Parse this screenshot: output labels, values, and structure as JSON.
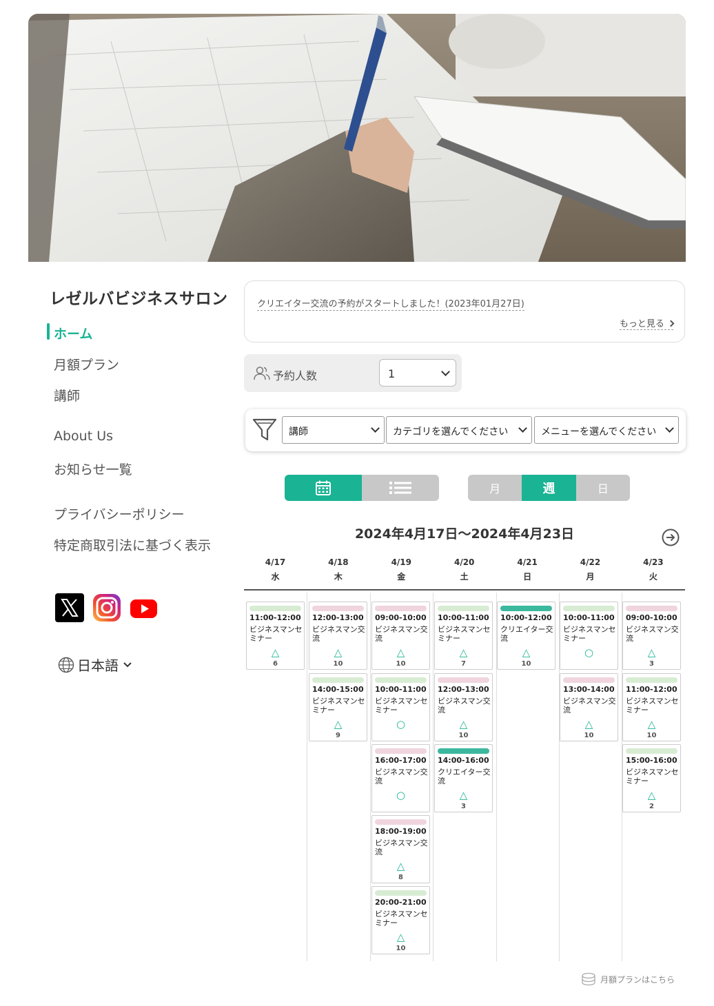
{
  "brand": "レゼルバビジネスサロン",
  "nav": {
    "home": "ホーム",
    "monthly": "月額プラン",
    "instructor": "講師",
    "about": "About Us",
    "news_list": "お知らせ一覧",
    "privacy": "プライバシーポリシー",
    "tokusho": "特定商取引法に基づく表示"
  },
  "language": "日本語",
  "news": {
    "item": "クリエイター交流の予約がスタートしました！(2023年01月27日)",
    "more": "もっと見る"
  },
  "people": {
    "label": "予約人数",
    "value": "1"
  },
  "filters": {
    "instructor": "講師",
    "category": "カテゴリを選んでください",
    "menu": "メニューを選んでください"
  },
  "range": {
    "month": "月",
    "week": "週",
    "day": "日",
    "selected": "week"
  },
  "period": "2024年4月17日～2024年4月23日",
  "colors": {
    "accent": "#1ab394",
    "seminar": "#d8ecd3",
    "exchange": "#f0d5de",
    "creator": "#3cb89e"
  },
  "days": [
    {
      "date": "4/17",
      "dow": "水",
      "slots": [
        {
          "time": "11:00-12:00",
          "title": "ビジネスマンセミナー",
          "type": "seminar",
          "mark": "△",
          "count": "6"
        }
      ]
    },
    {
      "date": "4/18",
      "dow": "木",
      "slots": [
        {
          "time": "12:00-13:00",
          "title": "ビジネスマン交流",
          "type": "exchange",
          "mark": "△",
          "count": "10"
        },
        {
          "time": "14:00-15:00",
          "title": "ビジネスマンセミナー",
          "type": "seminar",
          "mark": "△",
          "count": "9"
        }
      ]
    },
    {
      "date": "4/19",
      "dow": "金",
      "slots": [
        {
          "time": "09:00-10:00",
          "title": "ビジネスマン交流",
          "type": "exchange",
          "mark": "△",
          "count": "10"
        },
        {
          "time": "10:00-11:00",
          "title": "ビジネスマンセミナー",
          "type": "seminar",
          "mark": "○",
          "count": ""
        },
        {
          "time": "16:00-17:00",
          "title": "ビジネスマン交流",
          "type": "exchange",
          "mark": "○",
          "count": ""
        },
        {
          "time": "18:00-19:00",
          "title": "ビジネスマン交流",
          "type": "exchange",
          "mark": "△",
          "count": "8"
        },
        {
          "time": "20:00-21:00",
          "title": "ビジネスマンセミナー",
          "type": "seminar",
          "mark": "△",
          "count": "10"
        }
      ]
    },
    {
      "date": "4/20",
      "dow": "土",
      "slots": [
        {
          "time": "10:00-11:00",
          "title": "ビジネスマンセミナー",
          "type": "seminar",
          "mark": "△",
          "count": "7"
        },
        {
          "time": "12:00-13:00",
          "title": "ビジネスマン交流",
          "type": "exchange",
          "mark": "△",
          "count": "10"
        },
        {
          "time": "14:00-16:00",
          "title": "クリエイター交流",
          "type": "creator",
          "mark": "△",
          "count": "3"
        }
      ]
    },
    {
      "date": "4/21",
      "dow": "日",
      "slots": [
        {
          "time": "10:00-12:00",
          "title": "クリエイター交流",
          "type": "creator",
          "mark": "△",
          "count": "10"
        }
      ]
    },
    {
      "date": "4/22",
      "dow": "月",
      "slots": [
        {
          "time": "10:00-11:00",
          "title": "ビジネスマンセミナー",
          "type": "seminar",
          "mark": "○",
          "count": ""
        },
        {
          "time": "13:00-14:00",
          "title": "ビジネスマン交流",
          "type": "exchange",
          "mark": "△",
          "count": "10"
        }
      ]
    },
    {
      "date": "4/23",
      "dow": "火",
      "slots": [
        {
          "time": "09:00-10:00",
          "title": "ビジネスマン交流",
          "type": "exchange",
          "mark": "△",
          "count": "3"
        },
        {
          "time": "11:00-12:00",
          "title": "ビジネスマンセミナー",
          "type": "seminar",
          "mark": "△",
          "count": "10"
        },
        {
          "time": "15:00-16:00",
          "title": "ビジネスマンセミナー",
          "type": "seminar",
          "mark": "△",
          "count": "2"
        }
      ]
    }
  ],
  "monthly_link": "月額プランはこちら"
}
